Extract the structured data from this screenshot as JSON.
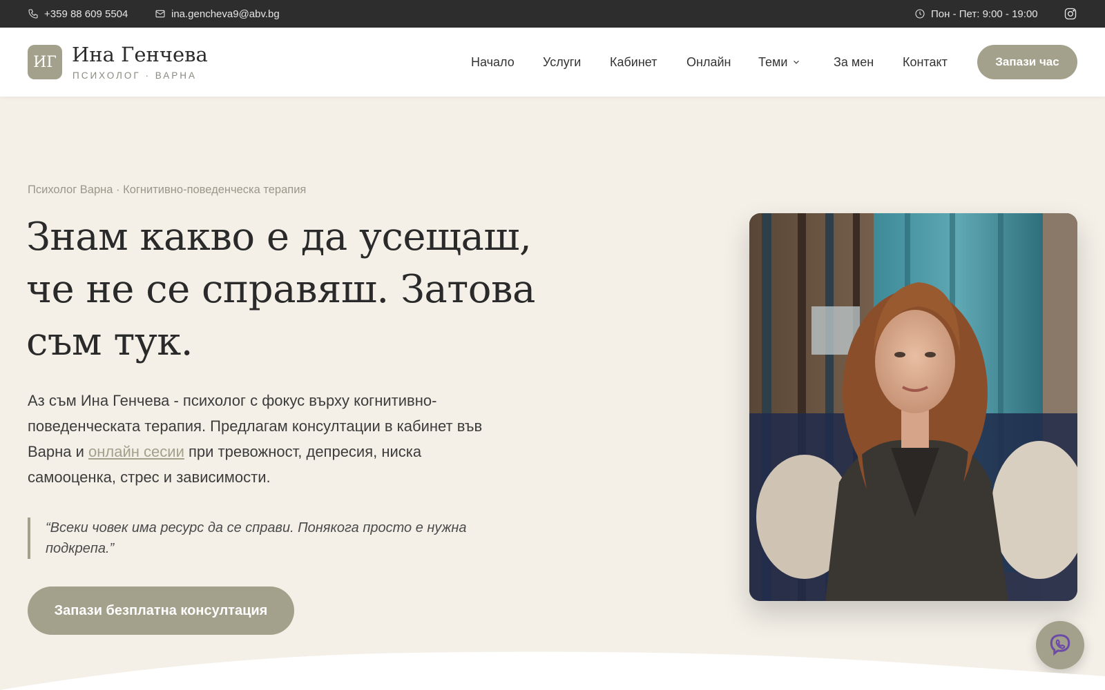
{
  "topbar": {
    "phone": "+359 88 609 5504",
    "email": "ina.gencheva9@abv.bg",
    "hours": "Пон - Пет: 9:00 - 19:00"
  },
  "header": {
    "logo_mark": "ИГ",
    "logo_name": "Ина Генчева",
    "logo_sub": "ПСИХОЛОГ · ВАРНА",
    "nav": [
      "Начало",
      "Услуги",
      "Кабинет",
      "Онлайн",
      "Теми",
      "За мен",
      "Контакт"
    ],
    "cta": "Запази час"
  },
  "hero": {
    "eyebrow": "Психолог Варна · Когнитивно-поведенческа терапия",
    "title_lines": [
      "Знам какво е да усещаш,",
      "че не се справяш. Затова",
      "съм тук."
    ],
    "text_line1": "Аз съм Ина Генчева - психолог с фокус върху когнитивно-",
    "text_line2": "поведенческата терапия. Предлагам консултации в кабинет във",
    "text_line3_before": "Варна и ",
    "text_link": "онлайн сесии",
    "text_line3_after": " при тревожност, депресия, ниска",
    "text_line4": "самооценка, стрес и зависимости.",
    "quote_lines": [
      "“Всеки човек има ресурс да се справи. Понякога просто е нужна",
      "подкрепа.”"
    ],
    "cta": "Запази безплатна консултация"
  },
  "colors": {
    "accent": "#a3a08b",
    "background": "#f4f0e8",
    "topbar": "#2d2d2d",
    "viber": "#6c4aa8"
  },
  "icons": [
    "phone-icon",
    "mail-icon",
    "clock-icon",
    "instagram-icon",
    "chevron-down-icon",
    "viber-icon"
  ]
}
